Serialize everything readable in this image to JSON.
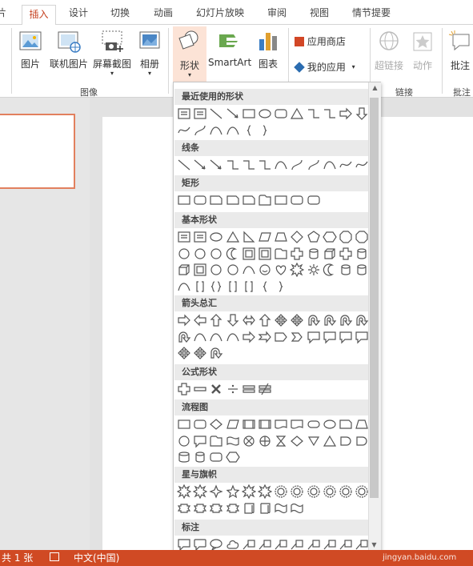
{
  "tabs": [
    "片",
    "插入",
    "设计",
    "切换",
    "动画",
    "幻灯片放映",
    "审阅",
    "视图",
    "情节提要"
  ],
  "ribbon": {
    "picture": "图片",
    "online_picture": "联机图片",
    "screenshot": "屏幕截图",
    "album": "相册",
    "group_images": "图像",
    "shapes": "形状",
    "smartart": "SmartArt",
    "chart": "图表",
    "app_store": "应用商店",
    "my_apps": "我的应用",
    "hyperlink": "超链接",
    "action": "动作",
    "group_links": "链接",
    "comment": "批注",
    "group_comments": "批注"
  },
  "dropdown": {
    "sections": [
      "最近使用的形状",
      "线条",
      "矩形",
      "基本形状",
      "箭头总汇",
      "公式形状",
      "流程图",
      "星与旗帜",
      "标注"
    ]
  },
  "status": {
    "slide_count": "共 1 张",
    "language": "中文(中国)",
    "watermark": "jingyan.baidu.com"
  },
  "colors": {
    "accent": "#c43e1c",
    "status_bar": "#d04a24",
    "thumb_border": "#e2805e"
  }
}
